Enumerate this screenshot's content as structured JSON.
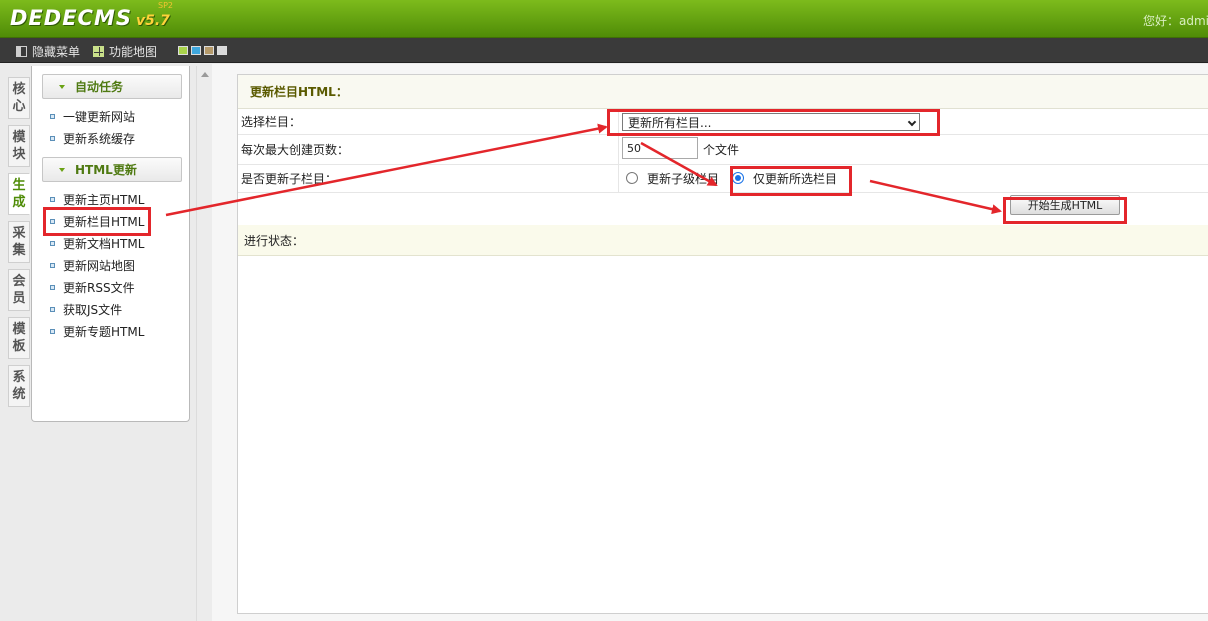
{
  "header": {
    "logo_text": "DEDECMS",
    "version": "v5.7",
    "version_sub": "SP2",
    "greeting": "您好：admin"
  },
  "toolbar": {
    "hide_menu": "隐藏菜单",
    "function_map": "功能地图",
    "skin_colors": [
      "#a9d34b",
      "#3fa7dd",
      "#b59a6b",
      "#d9d9d9"
    ]
  },
  "vtabs": [
    {
      "label": "核心"
    },
    {
      "label": "模块"
    },
    {
      "label": "生成"
    },
    {
      "label": "采集"
    },
    {
      "label": "会员"
    },
    {
      "label": "模板"
    },
    {
      "label": "系统"
    }
  ],
  "menu": {
    "group_auto": "自动任务",
    "auto_items": [
      "一键更新网站",
      "更新系统缓存"
    ],
    "group_html": "HTML更新",
    "html_items": [
      "更新主页HTML",
      "更新栏目HTML",
      "更新文档HTML",
      "更新网站地图",
      "更新RSS文件",
      "获取JS文件",
      "更新专题HTML"
    ]
  },
  "form": {
    "title": "更新栏目HTML：",
    "select_label": "选择栏目：",
    "select_value": "更新所有栏目...",
    "max_pages_label": "每次最大创建页数：",
    "max_pages_value": "50",
    "max_pages_unit": "个文件",
    "update_children_label": "是否更新子栏目：",
    "radio_children": "更新子级栏目",
    "radio_selected_only": "仅更新所选栏目",
    "generate_button": "开始生成HTML",
    "status_label": "进行状态："
  },
  "annotation_color": "#e3262b"
}
